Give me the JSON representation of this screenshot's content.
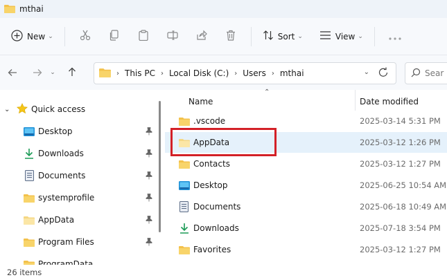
{
  "window": {
    "title": "mthai"
  },
  "toolbar": {
    "new_label": "New",
    "sort_label": "Sort",
    "view_label": "View",
    "icons": [
      "cut-icon",
      "copy-icon",
      "paste-icon",
      "rename-icon",
      "share-icon",
      "delete-icon",
      "more-icon"
    ]
  },
  "address": {
    "crumbs": [
      "This PC",
      "Local Disk (C:)",
      "Users",
      "mthai"
    ]
  },
  "search": {
    "placeholder": "Sear"
  },
  "sidebar": {
    "quick_access": "Quick access",
    "items": [
      {
        "label": "Desktop",
        "icon": "desktop-icon"
      },
      {
        "label": "Downloads",
        "icon": "download-icon"
      },
      {
        "label": "Documents",
        "icon": "documents-icon"
      },
      {
        "label": "systemprofile",
        "icon": "folder-icon"
      },
      {
        "label": "AppData",
        "icon": "folder-icon"
      },
      {
        "label": "Program Files",
        "icon": "folder-icon"
      },
      {
        "label": "ProgramData",
        "icon": "folder-icon"
      }
    ]
  },
  "columns": {
    "name": "Name",
    "date": "Date modified"
  },
  "files": [
    {
      "name": ".vscode",
      "date": "2025-03-14 5:31 PM",
      "icon": "folder-icon"
    },
    {
      "name": "AppData",
      "date": "2025-03-12 1:26 PM",
      "icon": "folder-icon",
      "selected": true
    },
    {
      "name": "Contacts",
      "date": "2025-03-12 1:27 PM",
      "icon": "folder-icon"
    },
    {
      "name": "Desktop",
      "date": "2025-06-25 10:54 AM",
      "icon": "desktop-icon"
    },
    {
      "name": "Documents",
      "date": "2025-06-18 10:49 AM",
      "icon": "documents-icon"
    },
    {
      "name": "Downloads",
      "date": "2025-07-18 3:54 PM",
      "icon": "download-icon"
    },
    {
      "name": "Favorites",
      "date": "2025-03-12 1:27 PM",
      "icon": "folder-icon"
    }
  ],
  "status": {
    "count": "26 items"
  },
  "colors": {
    "accent": "#0067c0",
    "folder": "#f3c14b",
    "highlight": "#d32027",
    "selection": "#e5f1fb"
  }
}
